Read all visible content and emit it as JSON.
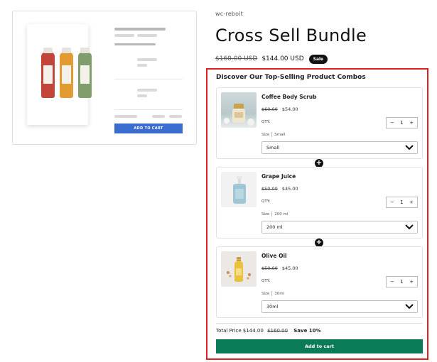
{
  "gallery": {
    "button_label": "ADD TO CART"
  },
  "product": {
    "vendor": "wc-reboit",
    "title": "Cross Sell Bundle",
    "old_price": "$160.00 USD",
    "price": "$144.00 USD",
    "badge": "Sale"
  },
  "bundle": {
    "heading": "Discover Our Top-Selling Product Combos",
    "items": [
      {
        "name": "Coffee Body Scrub",
        "compare_price": "$60.00",
        "price": "$54.00",
        "qty_label": "QTY:",
        "qty": "1",
        "option_label": "Size",
        "option_value": "Small",
        "select_value": "Small",
        "image": "coffee-scrub-jar"
      },
      {
        "name": "Grape Juice",
        "compare_price": "$50.00",
        "price": "$45.00",
        "qty_label": "QTY:",
        "qty": "1",
        "option_label": "Size",
        "option_value": "200 ml",
        "select_value": "200 ml",
        "image": "pump-bottle"
      },
      {
        "name": "Olive Oil",
        "compare_price": "$50.00",
        "price": "$45.00",
        "qty_label": "QTY:",
        "qty": "1",
        "option_label": "Size",
        "option_value": "30ml",
        "select_value": "30ml",
        "image": "oil-bottle"
      }
    ],
    "total_label": "Total Price",
    "total_price": "$144.00",
    "total_compare": "$160.00",
    "save_text": "Save 10%",
    "add_to_cart": "Add to cart"
  },
  "icons": {
    "minus": "−",
    "plus": "+",
    "combo": "+"
  },
  "colors": {
    "accent_green": "#0b7a56",
    "highlight_red": "#e02020",
    "badge_black": "#121212",
    "mock_button_blue": "#3b6ccf"
  }
}
